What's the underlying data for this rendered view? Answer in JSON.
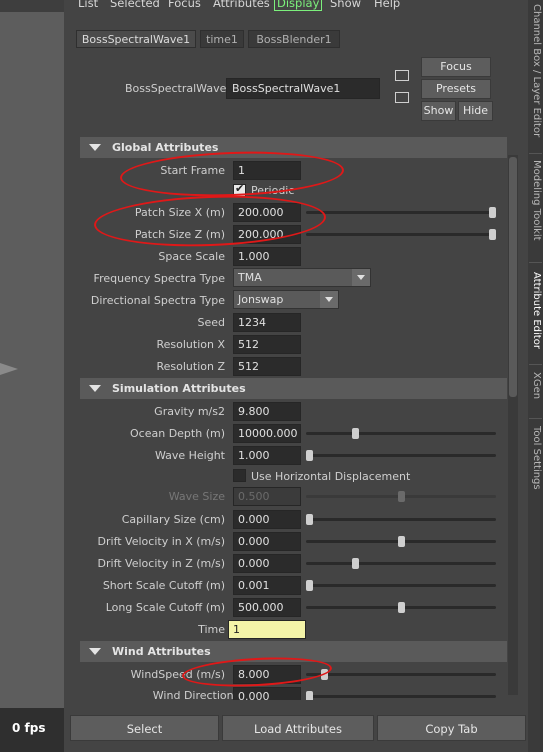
{
  "menubar": {
    "items": [
      "List",
      "Selected",
      "Focus",
      "Attributes",
      "Display",
      "Show",
      "Help"
    ],
    "active": "Display"
  },
  "tabs": [
    "BossSpectralWave1",
    "time1",
    "BossBlender1"
  ],
  "node": {
    "label": "BossSpectralWave:",
    "value": "BossSpectralWave1",
    "buttons": {
      "focus": "Focus",
      "presets": "Presets",
      "show": "Show",
      "hide": "Hide"
    }
  },
  "sections": {
    "global": "Global Attributes",
    "simulation": "Simulation Attributes",
    "wind": "Wind Attributes"
  },
  "global": {
    "start_frame": {
      "label": "Start Frame",
      "value": "1"
    },
    "periodic": {
      "label": "Periodic",
      "checked": true
    },
    "patch_x": {
      "label": "Patch Size X (m)",
      "value": "200.000",
      "slider": 1.0
    },
    "patch_z": {
      "label": "Patch Size Z (m)",
      "value": "200.000",
      "slider": 1.0
    },
    "space_scale": {
      "label": "Space Scale",
      "value": "1.000"
    },
    "freq_spectra": {
      "label": "Frequency Spectra Type",
      "value": "TMA"
    },
    "dir_spectra": {
      "label": "Directional Spectra Type",
      "value": "Jonswap"
    },
    "seed": {
      "label": "Seed",
      "value": "1234"
    },
    "res_x": {
      "label": "Resolution X",
      "value": "512"
    },
    "res_z": {
      "label": "Resolution Z",
      "value": "512"
    }
  },
  "simulation": {
    "gravity": {
      "label": "Gravity m/s2",
      "value": "9.800"
    },
    "ocean_depth": {
      "label": "Ocean Depth (m)",
      "value": "10000.000",
      "slider": 0.25
    },
    "wave_height": {
      "label": "Wave Height",
      "value": "1.000",
      "slider": 0.0
    },
    "horiz_disp": {
      "label": "Use Horizontal Displacement",
      "checked": false
    },
    "wave_size": {
      "label": "Wave Size",
      "value": "0.500",
      "slider": 0.5
    },
    "capillary": {
      "label": "Capillary Size (cm)",
      "value": "0.000",
      "slider": 0.0
    },
    "drift_x": {
      "label": "Drift Velocity in X (m/s)",
      "value": "0.000",
      "slider": 0.5
    },
    "drift_z": {
      "label": "Drift Velocity in Z (m/s)",
      "value": "0.000",
      "slider": 0.25
    },
    "short_cut": {
      "label": "Short Scale Cutoff (m)",
      "value": "0.001",
      "slider": 0.0
    },
    "long_cut": {
      "label": "Long Scale Cutoff (m)",
      "value": "500.000",
      "slider": 0.5
    },
    "time": {
      "label": "Time",
      "value": "1"
    }
  },
  "wind": {
    "speed": {
      "label": "WindSpeed (m/s)",
      "value": "8.000",
      "slider": 0.08
    },
    "direction": {
      "label": "Wind Direction (degrees)",
      "value": "0.000"
    }
  },
  "bottom": {
    "select": "Select",
    "load": "Load Attributes",
    "copy": "Copy Tab"
  },
  "fps": "0 fps",
  "sidebar": [
    "Channel Box / Layer Editor",
    "Modeling Toolkit",
    "Attribute Editor",
    "XGen",
    "Tool Settings"
  ],
  "colors": {
    "annotation": "#e01818",
    "active_menu": "#7cf07c",
    "time_field": "#f4f4a8"
  }
}
